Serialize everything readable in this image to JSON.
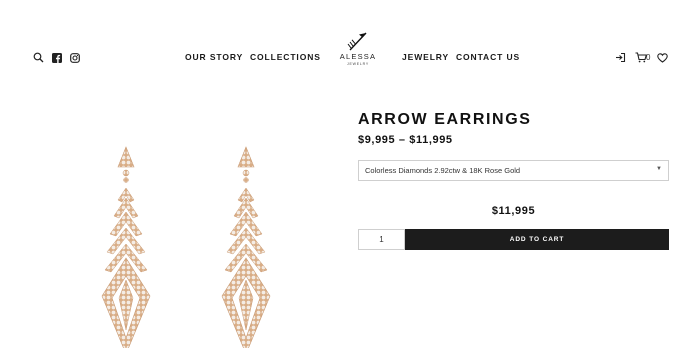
{
  "header": {
    "nav_left": [
      "OUR STORY",
      "COLLECTIONS"
    ],
    "nav_right": [
      "JEWELRY",
      "CONTACT US"
    ],
    "logo": {
      "name": "ALESSA",
      "sub": "JEWELRY"
    },
    "social_icons": [
      "search-icon",
      "facebook-icon",
      "instagram-icon"
    ],
    "utility_icons": [
      "login-icon",
      "cart-icon",
      "heart-icon"
    ],
    "cart_count": "0"
  },
  "product": {
    "title": "ARROW EARRINGS",
    "price_range": "$9,995 – $11,995",
    "variant_selected": "Colorless Diamonds 2.92ctw & 18K Rose Gold",
    "price": "$11,995",
    "quantity": "1",
    "add_to_cart_label": "ADD TO CART"
  },
  "colors": {
    "text": "#111111",
    "button_bg": "#1c1c1c",
    "border": "#cfcfcf",
    "gold": "#d9ad86",
    "diamond": "#f4ece4"
  }
}
